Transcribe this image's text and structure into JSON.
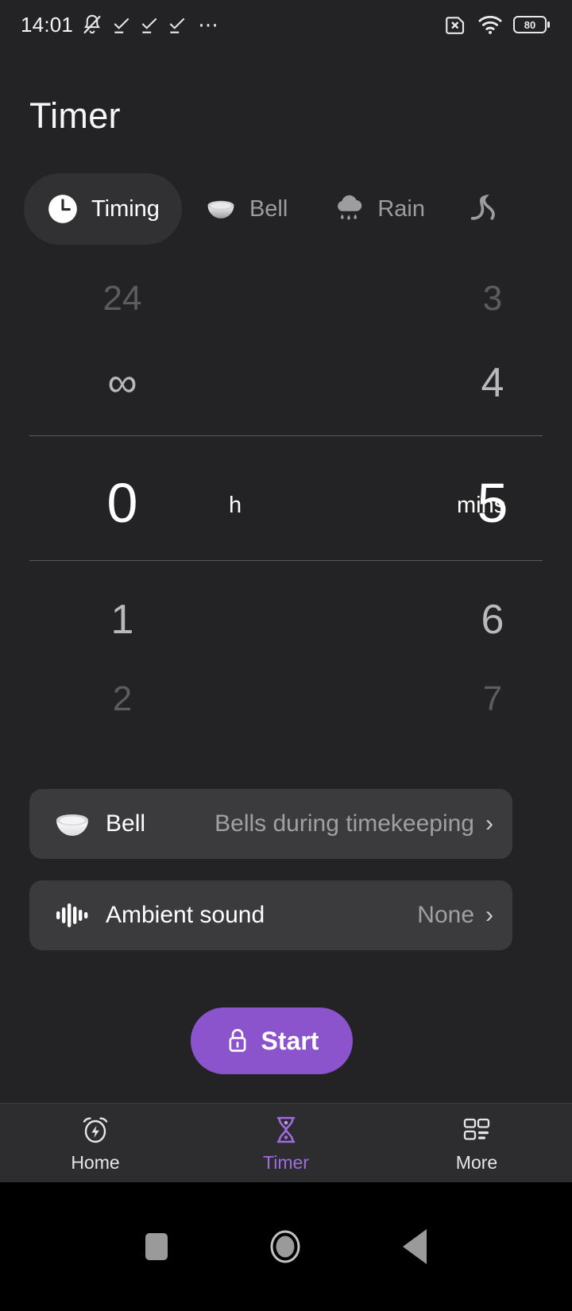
{
  "status_bar": {
    "time": "14:01",
    "battery_level": "80",
    "icons": [
      "bell-muted-icon",
      "check-icon",
      "check-icon",
      "check-icon",
      "overflow-dots-icon",
      "sim-error-icon",
      "wifi-icon",
      "battery-icon"
    ]
  },
  "header": {
    "title": "Timer"
  },
  "tabs": [
    {
      "label": "Timing",
      "icon": "clock-icon",
      "active": true
    },
    {
      "label": "Bell",
      "icon": "bowl-icon",
      "active": false
    },
    {
      "label": "Rain",
      "icon": "rain-cloud-icon",
      "active": false
    },
    {
      "label": "",
      "icon": "wave-icon",
      "active": false
    }
  ],
  "picker": {
    "hours": {
      "unit": "h",
      "far_above": "24",
      "near_above": "∞",
      "selected": "0",
      "near_below": "1",
      "far_below": "2"
    },
    "minutes": {
      "unit": "mins",
      "far_above": "3",
      "near_above": "4",
      "selected": "5",
      "near_below": "6",
      "far_below": "7"
    }
  },
  "options": [
    {
      "title": "Bell",
      "value": "Bells during timekeeping",
      "icon": "bowl-icon",
      "chevron": "›"
    },
    {
      "title": "Ambient sound",
      "value": "None",
      "icon": "waveform-icon",
      "chevron": "›"
    }
  ],
  "start_button": {
    "label": "Start",
    "icon": "lock-icon",
    "color": "#8b54cd"
  },
  "bottom_nav": [
    {
      "label": "Home",
      "icon": "alarm-flash-icon",
      "active": false
    },
    {
      "label": "Timer",
      "icon": "hourglass-icon",
      "active": true
    },
    {
      "label": "More",
      "icon": "grid-icon",
      "active": false
    }
  ],
  "system_nav": [
    {
      "icon": "recents-square-icon"
    },
    {
      "icon": "home-circle-icon"
    },
    {
      "icon": "back-triangle-icon"
    }
  ],
  "colors": {
    "accent": "#8b54cd",
    "nav_active": "#a06be0",
    "background": "#232325",
    "card": "#3b3b3d"
  }
}
